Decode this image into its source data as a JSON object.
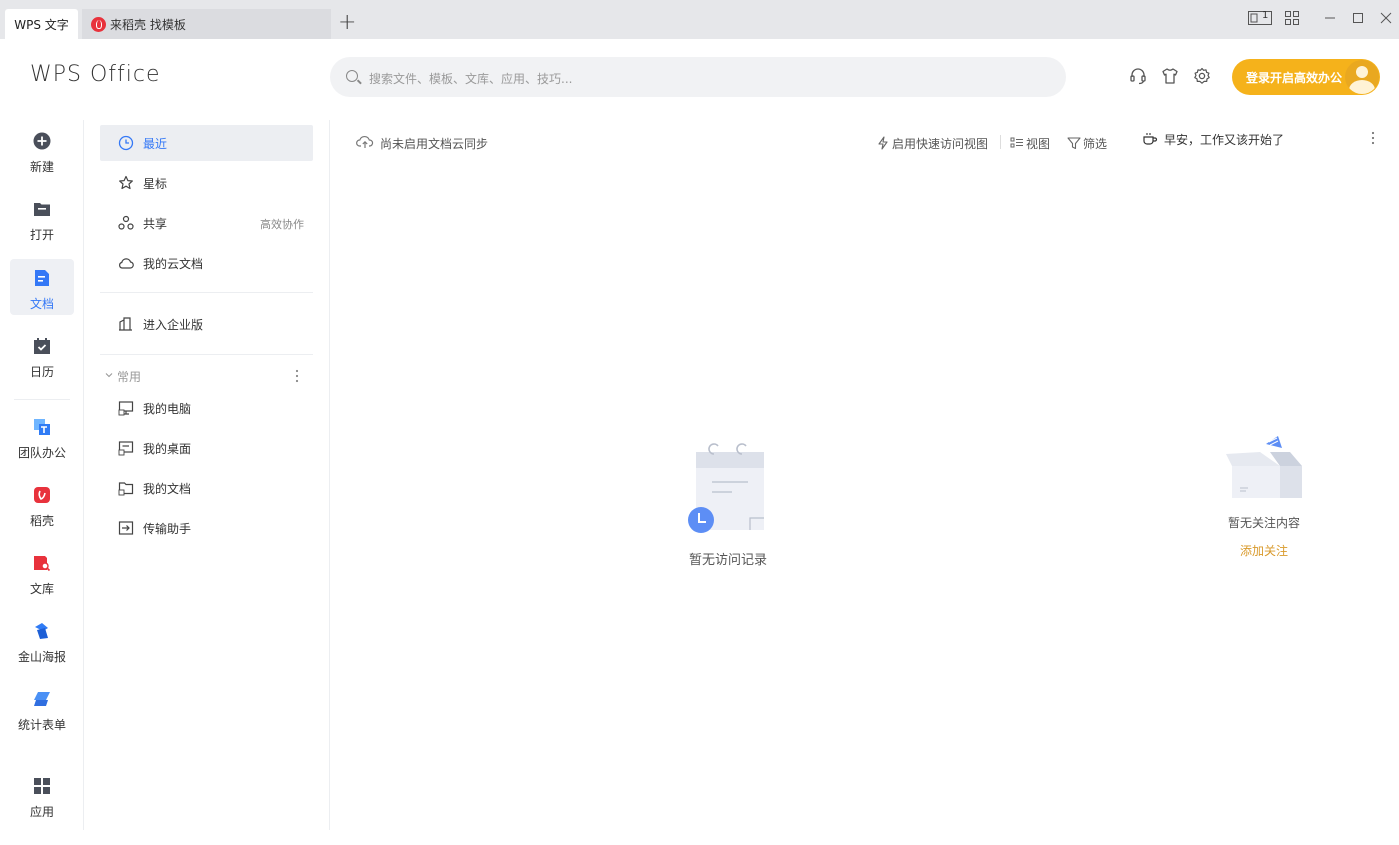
{
  "tabs": [
    {
      "label": "WPS 文字"
    },
    {
      "label": "来稻壳 找模板"
    }
  ],
  "header": {
    "logo_text": "WPS Office",
    "search_placeholder": "搜索文件、模板、文库、应用、技巧...",
    "login_label": "登录开启高效办公",
    "window_badge": "1"
  },
  "rail": {
    "items": [
      {
        "label": "新建",
        "icon": "plus-circle-icon"
      },
      {
        "label": "打开",
        "icon": "folder-icon"
      },
      {
        "label": "文档",
        "icon": "document-icon",
        "active": true
      },
      {
        "label": "日历",
        "icon": "calendar-icon"
      },
      {
        "label": "团队办公",
        "icon": "team-icon"
      },
      {
        "label": "稻壳",
        "icon": "docer-icon"
      },
      {
        "label": "文库",
        "icon": "library-icon"
      },
      {
        "label": "金山海报",
        "icon": "poster-icon"
      },
      {
        "label": "统计表单",
        "icon": "form-icon"
      },
      {
        "label": "应用",
        "icon": "apps-grid-icon"
      }
    ]
  },
  "nav": {
    "recent": "最近",
    "starred": "星标",
    "shared": "共享",
    "shared_hint": "高效协作",
    "cloud_docs": "我的云文档",
    "enterprise": "进入企业版",
    "common_section": "常用",
    "my_computer": "我的电脑",
    "my_desktop": "我的桌面",
    "my_documents": "我的文档",
    "transfer_helper": "传输助手"
  },
  "main": {
    "sync_status": "尚未启用文档云同步",
    "quick_access": "启用快速访问视图",
    "view": "视图",
    "filter": "筛选",
    "greeting": "早安，工作又该开始了",
    "empty_recent": "暂无访问记录",
    "empty_follow": "暂无关注内容",
    "add_follow": "添加关注"
  },
  "colors": {
    "accent": "#3478f6",
    "login_button": "#f5b21b",
    "link_orange": "#d99a2b",
    "docer_red": "#e8323c"
  }
}
